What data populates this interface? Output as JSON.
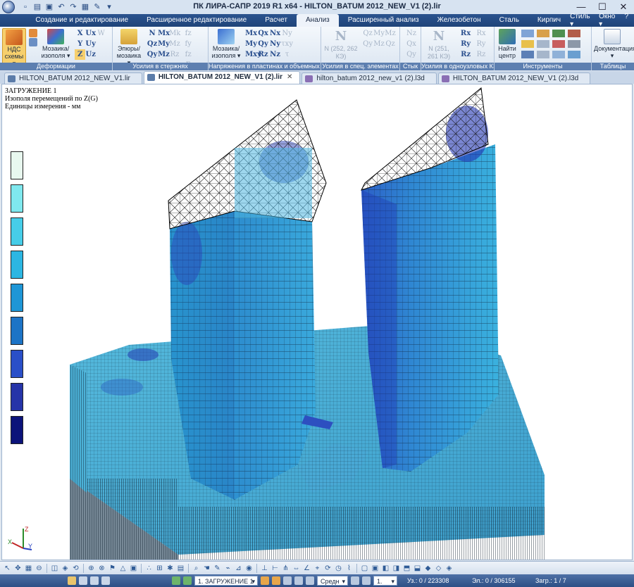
{
  "window": {
    "title": "ПК ЛИРА-САПР  2019 R1 x64 - HILTON_BATUM 2012_NEW_V1 (2).lir",
    "minimize": "—",
    "maximize": "☐",
    "close": "✕"
  },
  "menu": {
    "tabs": [
      "Создание и редактирование",
      "Расширенное редактирование",
      "Расчет",
      "Анализ",
      "Расширенный анализ",
      "Железобетон",
      "Сталь",
      "Кирпич"
    ],
    "active": "Анализ",
    "style": "Стиль ▾",
    "window_menu": "Окно ▾",
    "help": "?"
  },
  "ribbon": {
    "deform": {
      "ndc_label": "НДС схемы ▾",
      "mosaic_label": "Мозаика/ изополя ▾",
      "group": "Деформации",
      "syms": [
        "X",
        "Ux",
        "W",
        "Y",
        "Uy",
        "",
        "Z",
        "Uz",
        ""
      ]
    },
    "rods": {
      "epure_label": "Эпюры/ мозаика ▾",
      "group": "Усилия в стержнях",
      "syms": [
        "N",
        "Mx",
        "Mk",
        "Qz",
        "My",
        "Mz",
        "Qy",
        "Mz",
        "Rz"
      ],
      "extra": [
        "fz",
        "fy",
        "fz",
        "Σ"
      ]
    },
    "plates": {
      "mosaic_label": "Мозаика/ изополя ▾",
      "group": "Напряжения в пластинах и объемных КЭ",
      "syms": [
        "Mx",
        "Qx",
        "Nx",
        "Ny",
        "My",
        "Qy",
        "Ny",
        "τxy",
        "Mxy",
        "Rz",
        "Nz",
        "τ"
      ]
    },
    "special": {
      "group": "Усилия в спец. элементах",
      "text": "N (252, 262 КЭ)",
      "syms": [
        "Qz",
        "My",
        "Mz",
        "Qy",
        "Mz",
        "Qz"
      ]
    },
    "joint": {
      "group": "Стык",
      "syms": [
        "Nz",
        "Qx",
        "Qy"
      ]
    },
    "single": {
      "group": "Усилия в одноузловых КЭ",
      "text": "N (251, 261 КЭ)",
      "syms": [
        "Rx",
        "Rx",
        "Ry",
        "Ry",
        "Rz",
        "Rz"
      ]
    },
    "tools": {
      "group": "Инструменты",
      "find_label": "Найти центр"
    },
    "tables": {
      "group": "Таблицы",
      "doc_label": "Документация ▾"
    }
  },
  "doc_tabs": [
    {
      "label": "HILTON_BATUM 2012_NEW_V1.lir",
      "close": ""
    },
    {
      "label": "HILTON_BATUM 2012_NEW_V1 (2).lir",
      "close": "✕"
    },
    {
      "label": "hilton_batum 2012_new_v1 (2).l3d",
      "close": ""
    },
    {
      "label": "HILTON_BATUM 2012_NEW_V1 (2).l3d",
      "close": ""
    }
  ],
  "viewport": {
    "info_line1": "ЗАГРУЖЕНИЕ 1",
    "info_line2": "Изополя  перемещений по Z(G)",
    "info_line3": "Единицы измерения - мм",
    "legend_colors": [
      "#e8f8ef",
      "#7fe8ee",
      "#46cde8",
      "#2cb6e2",
      "#1e96d6",
      "#1d74c6",
      "#2a4fc8",
      "#2634a8",
      "#0b137a"
    ],
    "axes": {
      "z": "Z",
      "x": "X",
      "y": "Y"
    }
  },
  "status": {
    "loadcase": "1. ЗАГРУЖЕНИЕ 1",
    "view_mode": "Средн",
    "field_one": "1.",
    "nodes": "Уз.: 0 / 223308",
    "elements": "Эл.: 0 / 306155",
    "load_count": "Загр.: 1 / 7"
  },
  "colors": {
    "accent": "#2b538f",
    "ribbon_label": "#5d7fb0",
    "active_button": "#f6cf6d",
    "mesh": "#000000"
  }
}
